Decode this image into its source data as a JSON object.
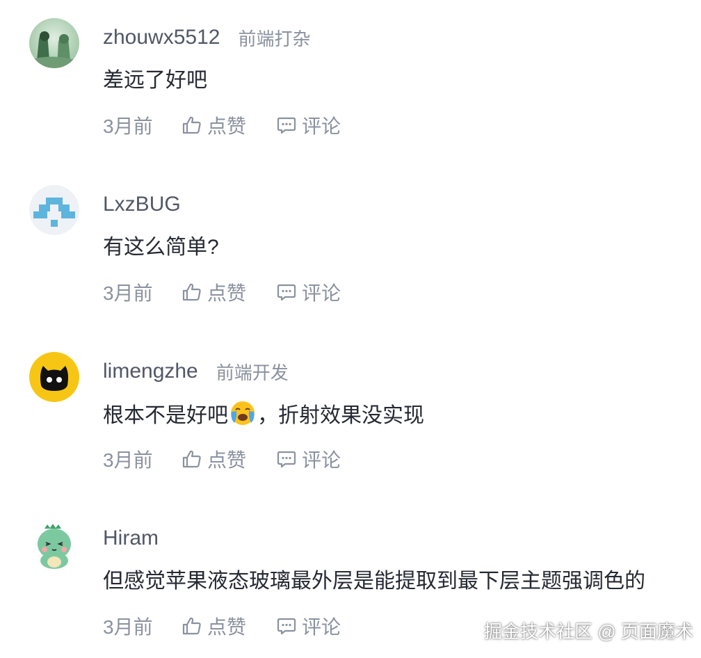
{
  "colors": {
    "username": "#515767",
    "job_title": "#8a919f",
    "content": "#252933",
    "meta": "#8a919f",
    "background": "#ffffff"
  },
  "comments": [
    {
      "avatar": "green-forest-couple-avatar",
      "username": "zhouwx5512",
      "job": "前端打杂",
      "text": "差远了好吧",
      "text_after_emoji": "",
      "time": "3月前",
      "like_label": "点赞",
      "comment_label": "评论"
    },
    {
      "avatar": "blue-pixel-invader-avatar",
      "username": "LxzBUG",
      "job": "",
      "text": "有这么简单?",
      "text_after_emoji": "",
      "time": "3月前",
      "like_label": "点赞",
      "comment_label": "评论"
    },
    {
      "avatar": "black-cat-yellow-avatar",
      "username": "limengzhe",
      "job": "前端开发",
      "text": "根本不是好吧",
      "emoji": "loudly-crying-emoji",
      "text_after_emoji": "，折射效果没实现",
      "time": "3月前",
      "like_label": "点赞",
      "comment_label": "评论"
    },
    {
      "avatar": "green-dinosaur-avatar",
      "username": "Hiram",
      "job": "",
      "text": "但感觉苹果液态玻璃最外层是能提取到最下层主题强调色的",
      "text_after_emoji": "",
      "time": "3月前",
      "like_label": "点赞",
      "comment_label": "评论"
    }
  ],
  "watermark": "掘金技术社区 @ 页面魔术"
}
